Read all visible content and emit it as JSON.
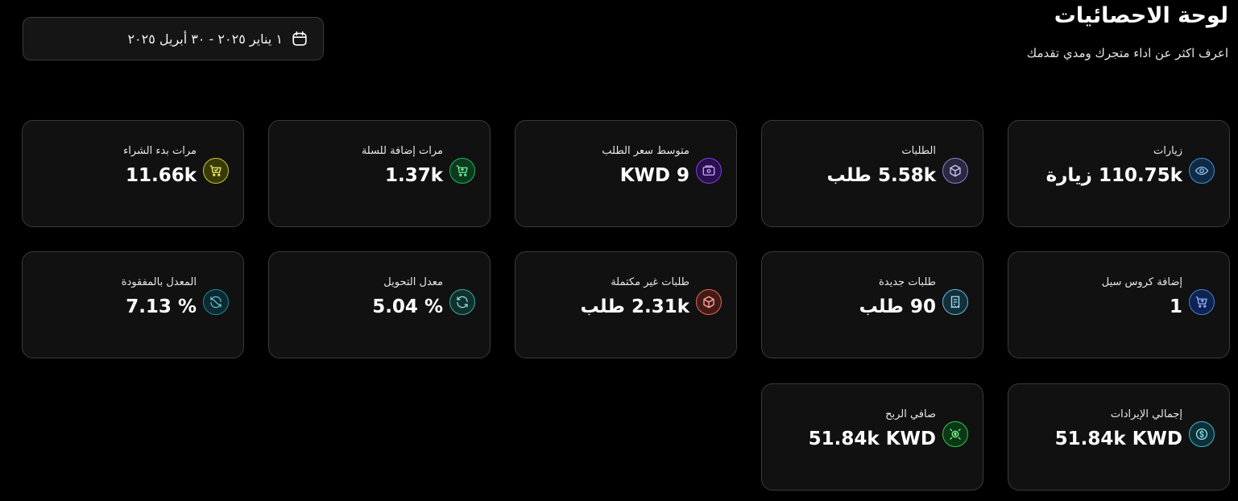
{
  "header": {
    "title": "لوحة الاحصائيات",
    "subtitle": "اعرف اكثر عن اداء متجرك ومدي تقدمك"
  },
  "date_range": {
    "label": "١ يناير ٢٠٢٥ - ٣٠ أبريل ٢٠٢٥"
  },
  "cards": {
    "visits": {
      "label": "زيارات",
      "value": "110.75k زيارة",
      "icon": "eye-icon",
      "color": "#3f8fd8"
    },
    "orders": {
      "label": "الطلبات",
      "value": "5.58k طلب",
      "icon": "box-icon",
      "color": "#8a82c8"
    },
    "avg_order": {
      "label": "متوسط سعر الطلب",
      "value": "KWD 9",
      "icon": "wallet-icon",
      "color": "#7b3fe4"
    },
    "add_to_cart": {
      "label": "مرات إضافة للسلة",
      "value": "1.37k",
      "icon": "cart-icon",
      "color": "#1fb85a"
    },
    "checkout": {
      "label": "مرات بدء الشراء",
      "value": "11.66k",
      "icon": "cart-check-icon",
      "color": "#c8c81e"
    },
    "cross_sell": {
      "label": "إضافة كروس سيل",
      "value": "1",
      "icon": "cart-plus-icon",
      "color": "#3f7fe0"
    },
    "new_orders": {
      "label": "طلبات جديدة",
      "value": "90 طلب",
      "icon": "receipt-icon",
      "color": "#6ab4d8"
    },
    "incomplete_orders": {
      "label": "طلبات غير مكتملة",
      "value": "2.31k طلب",
      "icon": "box-alert-icon",
      "color": "#e0685a"
    },
    "conversion": {
      "label": "معدل التحويل",
      "value": "% 5.04",
      "icon": "refresh-icon",
      "color": "#3aa8a0"
    },
    "loss_rate": {
      "label": "المعدل بالمفقودة",
      "value": "% 7.13",
      "icon": "refresh-off-icon",
      "color": "#1f8a96"
    },
    "total_revenue": {
      "label": "إجمالي الإيرادات",
      "value": "51.84k KWD",
      "icon": "dollar-coin-icon",
      "color": "#3ab8c8"
    },
    "net_profit": {
      "label": "صافي الربح",
      "value": "51.84k KWD",
      "icon": "money-icon",
      "color": "#2ec84a"
    }
  }
}
